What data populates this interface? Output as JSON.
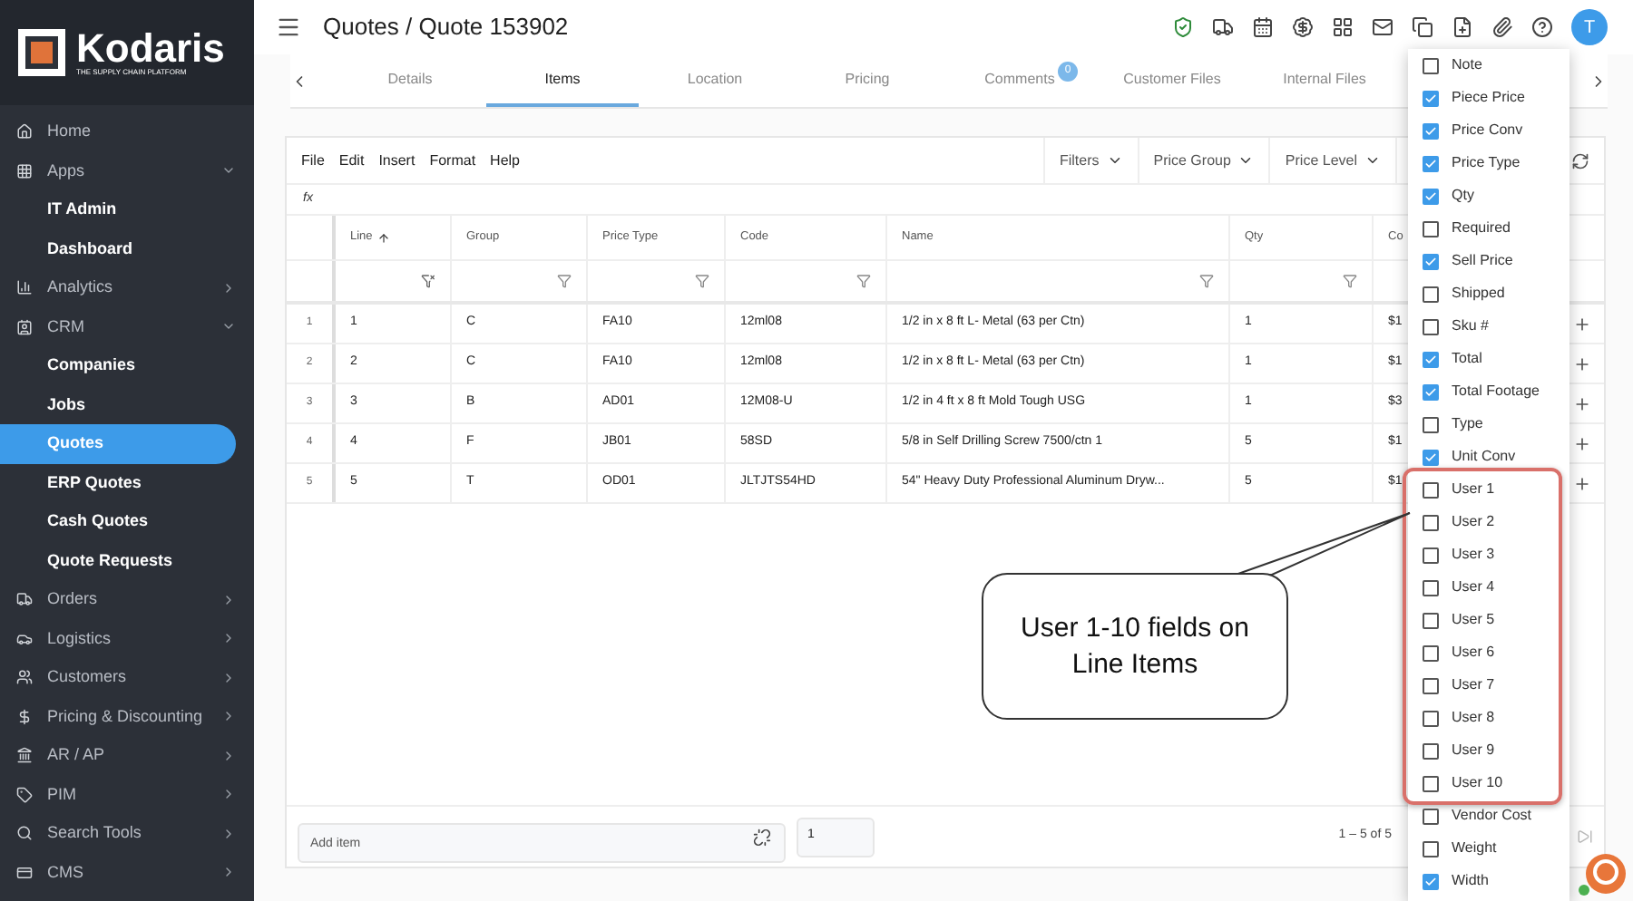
{
  "logo": {
    "name": "Kodaris",
    "tagline": "THE SUPPLY CHAIN PLATFORM"
  },
  "sidebar": {
    "items": [
      {
        "label": "Home",
        "kind": "section",
        "selected": false
      },
      {
        "label": "Apps",
        "kind": "section",
        "expanded": true,
        "selected": false
      },
      {
        "label": "IT Admin",
        "kind": "sub",
        "selected": false
      },
      {
        "label": "Dashboard",
        "kind": "sub",
        "selected": false
      },
      {
        "label": "Analytics",
        "kind": "section",
        "expanded": false,
        "selected": false
      },
      {
        "label": "CRM",
        "kind": "section",
        "expanded": true,
        "selected": false
      },
      {
        "label": "Companies",
        "kind": "sub",
        "selected": false
      },
      {
        "label": "Jobs",
        "kind": "sub",
        "selected": false
      },
      {
        "label": "Quotes",
        "kind": "sub",
        "selected": true
      },
      {
        "label": "ERP Quotes",
        "kind": "sub",
        "selected": false
      },
      {
        "label": "Cash Quotes",
        "kind": "sub",
        "selected": false
      },
      {
        "label": "Quote Requests",
        "kind": "sub",
        "selected": false
      },
      {
        "label": "Orders",
        "kind": "section",
        "expanded": false,
        "selected": false
      },
      {
        "label": "Logistics",
        "kind": "section",
        "expanded": false,
        "selected": false
      },
      {
        "label": "Customers",
        "kind": "section",
        "expanded": false,
        "selected": false
      },
      {
        "label": "Pricing & Discounting",
        "kind": "section",
        "expanded": false,
        "selected": false
      },
      {
        "label": "AR / AP",
        "kind": "section",
        "expanded": false,
        "selected": false
      },
      {
        "label": "PIM",
        "kind": "section",
        "expanded": false,
        "selected": false
      },
      {
        "label": "Search Tools",
        "kind": "section",
        "expanded": false,
        "selected": false
      },
      {
        "label": "CMS",
        "kind": "section",
        "expanded": false,
        "selected": false
      }
    ]
  },
  "header": {
    "title": "Quotes / Quote 153902",
    "avatar": "T"
  },
  "tabs": [
    {
      "label": "Details",
      "selected": false
    },
    {
      "label": "Items",
      "selected": true
    },
    {
      "label": "Location",
      "selected": false
    },
    {
      "label": "Pricing",
      "selected": false
    },
    {
      "label": "Comments",
      "selected": false,
      "badge": "0"
    },
    {
      "label": "Customer Files",
      "selected": false
    },
    {
      "label": "Internal Files",
      "selected": false
    }
  ],
  "toolbar": {
    "menus": [
      "File",
      "Edit",
      "Insert",
      "Format",
      "Help"
    ],
    "dropdowns": [
      "Filters",
      "Price Group",
      "Price Level"
    ],
    "formula_label": "fx"
  },
  "table": {
    "columns": [
      {
        "label": "Line",
        "sorted": true
      },
      {
        "label": "Group",
        "sorted": false
      },
      {
        "label": "Price Type",
        "sorted": false
      },
      {
        "label": "Code",
        "sorted": false
      },
      {
        "label": "Name",
        "sorted": false
      },
      {
        "label": "Qty",
        "sorted": false
      },
      {
        "label": "Co"
      }
    ],
    "rows": [
      {
        "number": "1",
        "cells": [
          "1",
          "C",
          "FA10",
          "12ml08",
          "1/2 in x 8 ft L- Metal (63 per Ctn)",
          "1",
          "$1"
        ]
      },
      {
        "number": "2",
        "cells": [
          "2",
          "C",
          "FA10",
          "12ml08",
          "1/2 in x 8 ft L- Metal (63 per Ctn)",
          "1",
          "$1"
        ]
      },
      {
        "number": "3",
        "cells": [
          "3",
          "B",
          "AD01",
          "12M08-U",
          "1/2 in 4 ft x 8 ft Mold Tough USG",
          "1",
          "$3"
        ]
      },
      {
        "number": "4",
        "cells": [
          "4",
          "F",
          "JB01",
          "58SD",
          "5/8 in Self Drilling Screw 7500/ctn 1",
          "5",
          "$1"
        ]
      },
      {
        "number": "5",
        "cells": [
          "5",
          "T",
          "OD01",
          "JLTJTS54HD",
          "54\" Heavy Duty Professional Aluminum Dryw...",
          "5",
          "$1"
        ]
      }
    ]
  },
  "footer": {
    "add_item": {
      "placeholder": "Add item"
    },
    "quantity": "1",
    "pagination": "1 – 5 of 5"
  },
  "column_menu": {
    "items": [
      {
        "label": "Note",
        "checked": false
      },
      {
        "label": "Piece Price",
        "checked": true
      },
      {
        "label": "Price Conv",
        "checked": true
      },
      {
        "label": "Price Type",
        "checked": true
      },
      {
        "label": "Qty",
        "checked": true
      },
      {
        "label": "Required",
        "checked": false
      },
      {
        "label": "Sell Price",
        "checked": true
      },
      {
        "label": "Shipped",
        "checked": false
      },
      {
        "label": "Sku #",
        "checked": false
      },
      {
        "label": "Total",
        "checked": true
      },
      {
        "label": "Total Footage",
        "checked": true
      },
      {
        "label": "Type",
        "checked": false
      },
      {
        "label": "Unit Conv",
        "checked": true
      }
    ],
    "highlighted_items": [
      {
        "label": "User 1",
        "checked": false
      },
      {
        "label": "User 2",
        "checked": false
      },
      {
        "label": "User 3",
        "checked": false
      },
      {
        "label": "User 4",
        "checked": false
      },
      {
        "label": "User 5",
        "checked": false
      },
      {
        "label": "User 6",
        "checked": false
      },
      {
        "label": "User 7",
        "checked": false
      },
      {
        "label": "User 8",
        "checked": false
      },
      {
        "label": "User 9",
        "checked": false
      },
      {
        "label": "User 10",
        "checked": false
      }
    ],
    "more_items": [
      {
        "label": "Vendor Cost",
        "checked": false
      },
      {
        "label": "Weight",
        "checked": false
      },
      {
        "label": "Width",
        "checked": true
      }
    ]
  },
  "callout": {
    "text": "User 1-10 fields on Line Items"
  }
}
